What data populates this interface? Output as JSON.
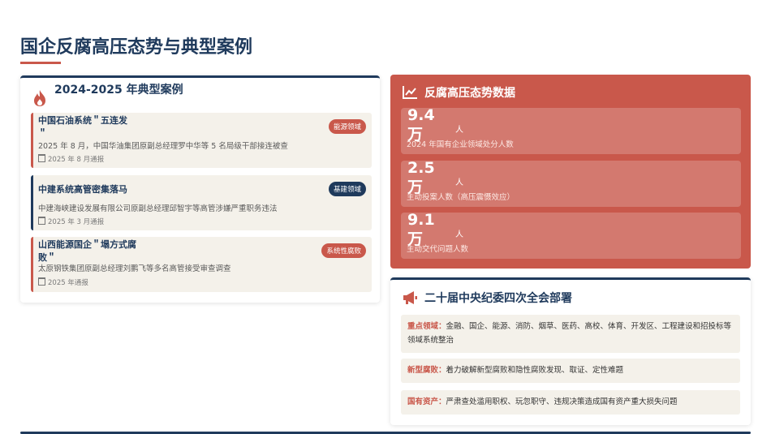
{
  "page": {
    "title": "国企反腐高压态势与典型案例"
  },
  "cases_panel": {
    "title": "2024-2025 年典型案例",
    "cases": [
      {
        "title": "中国石油系统＂五连发＂",
        "badge": "能源领域",
        "desc": "2025 年 8 月，中国华油集团原副总经理罗中华等 5 名局级干部接连被查",
        "date": "2025 年 8 月通报"
      },
      {
        "title": "中建系统高管密集落马",
        "badge": "基建领域",
        "desc": "中建海峡建设发展有限公司原副总经理邱智宇等高管涉嫌严重职务违法",
        "date": "2025 年 3 月通报"
      },
      {
        "title": "山西能源国企＂塌方式腐败＂",
        "badge": "系统性腐败",
        "desc": "太原钢铁集团原副总经理刘鹏飞等多名高管接受审查调查",
        "date": "2025 年通报"
      }
    ]
  },
  "stats_panel": {
    "title": "反腐高压态势数据",
    "stats": [
      {
        "value": "9.4 万",
        "unit": "人",
        "label": "2024 年国有企业领域处分人数"
      },
      {
        "value": "2.5 万",
        "unit": "人",
        "label": "主动投案人数（高压震慑效应）"
      },
      {
        "value": "9.1 万",
        "unit": "人",
        "label": "主动交代问题人数"
      }
    ]
  },
  "deploy_panel": {
    "title": "二十届中央纪委四次全会部署",
    "items": [
      {
        "label": "重点领域：",
        "text": "金融、国企、能源、消防、烟草、医药、高校、体育、开发区、工程建设和招投标等领域系统整治"
      },
      {
        "label": "新型腐败：",
        "text": "着力破解新型腐败和隐性腐败发现、取证、定性难题"
      },
      {
        "label": "国有资产：",
        "text": "严肃查处滥用职权、玩忽职守、违规决策造成国有资产重大损失问题"
      }
    ]
  },
  "colors": {
    "accent": "#c9584b",
    "navy": "#1f3a5c",
    "card_bg": "#f4f1ea"
  },
  "icons": {
    "cases": "fire-icon",
    "stats": "line-chart-icon",
    "deploy": "megaphone-icon",
    "date": "calendar-icon"
  }
}
